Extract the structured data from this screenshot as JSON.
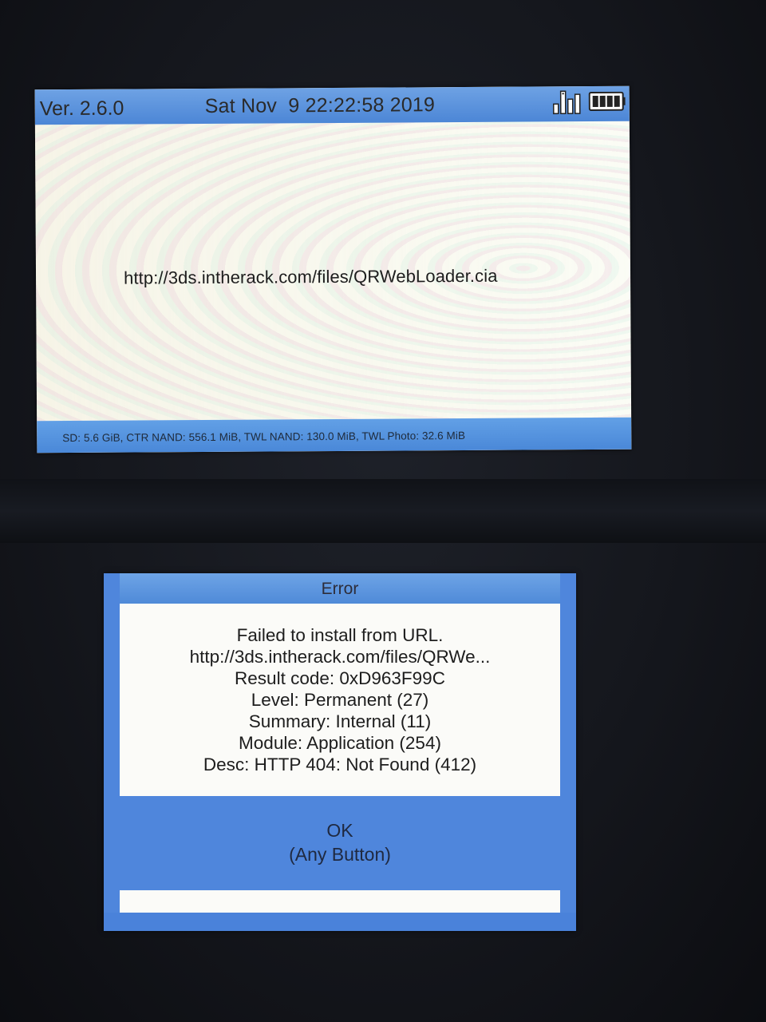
{
  "top_screen": {
    "version": "Ver. 2.6.0",
    "datetime": "Sat Nov  9 22:22:58 2019",
    "url": "http://3ds.intherack.com/files/QRWebLoader.cia",
    "storage_info": "SD: 5.6 GiB, CTR NAND: 556.1 MiB, TWL NAND: 130.0 MiB, TWL Photo: 32.6 MiB",
    "icons": [
      "signal-icon",
      "battery-icon"
    ],
    "battery_level": 1.0
  },
  "dialog": {
    "title": "Error",
    "lines": [
      "Failed to install from URL.",
      "http://3ds.intherack.com/files/QRWe...",
      "Result code: 0xD963F99C",
      "Level: Permanent (27)",
      "Summary: Internal (11)",
      "Module: Application (254)",
      "Desc: HTTP 404: Not Found (412)"
    ],
    "ok_label": "OK",
    "ok_sublabel": "(Any Button)"
  },
  "colors": {
    "accent_blue": "#4f86dc",
    "screen_bg": "#fbfcf5",
    "text": "#1d1d1d"
  }
}
